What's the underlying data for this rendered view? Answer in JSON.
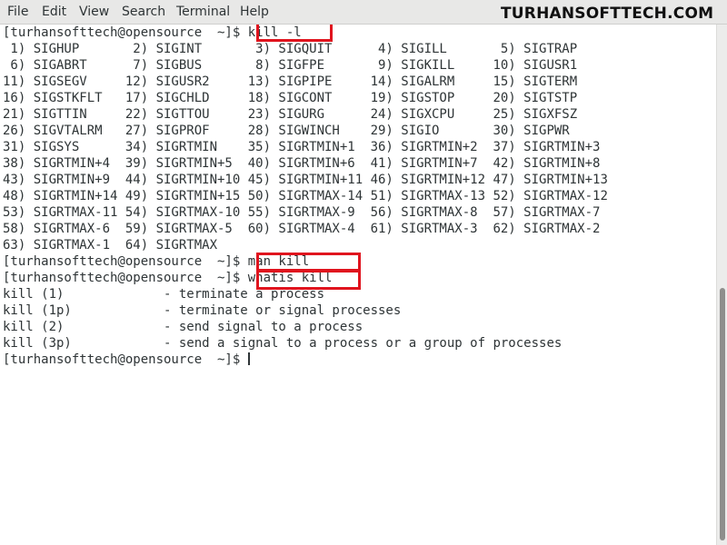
{
  "menu": {
    "file": "File",
    "edit": "Edit",
    "view": "View",
    "search": "Search",
    "terminal": "Terminal",
    "help": "Help"
  },
  "watermark": "TURHANSOFTTECH.COM",
  "terminal": {
    "lines": [
      "[turhansofttech@opensource  ~]$ kill -l",
      " 1) SIGHUP       2) SIGINT       3) SIGQUIT      4) SIGILL       5) SIGTRAP",
      " 6) SIGABRT      7) SIGBUS       8) SIGFPE       9) SIGKILL     10) SIGUSR1",
      "11) SIGSEGV     12) SIGUSR2     13) SIGPIPE     14) SIGALRM     15) SIGTERM",
      "16) SIGSTKFLT   17) SIGCHLD     18) SIGCONT     19) SIGSTOP     20) SIGTSTP",
      "21) SIGTTIN     22) SIGTTOU     23) SIGURG      24) SIGXCPU     25) SIGXFSZ",
      "26) SIGVTALRM   27) SIGPROF     28) SIGWINCH    29) SIGIO       30) SIGPWR",
      "31) SIGSYS      34) SIGRTMIN    35) SIGRTMIN+1  36) SIGRTMIN+2  37) SIGRTMIN+3",
      "38) SIGRTMIN+4  39) SIGRTMIN+5  40) SIGRTMIN+6  41) SIGRTMIN+7  42) SIGRTMIN+8",
      "43) SIGRTMIN+9  44) SIGRTMIN+10 45) SIGRTMIN+11 46) SIGRTMIN+12 47) SIGRTMIN+13",
      "48) SIGRTMIN+14 49) SIGRTMIN+15 50) SIGRTMAX-14 51) SIGRTMAX-13 52) SIGRTMAX-12",
      "53) SIGRTMAX-11 54) SIGRTMAX-10 55) SIGRTMAX-9  56) SIGRTMAX-8  57) SIGRTMAX-7",
      "58) SIGRTMAX-6  59) SIGRTMAX-5  60) SIGRTMAX-4  61) SIGRTMAX-3  62) SIGRTMAX-2",
      "63) SIGRTMAX-1  64) SIGRTMAX",
      "[turhansofttech@opensource  ~]$ man kill",
      "[turhansofttech@opensource  ~]$ whatis kill",
      "kill (1)             - terminate a process",
      "kill (1p)            - terminate or signal processes",
      "kill (2)             - send signal to a process",
      "kill (3p)            - send a signal to a process or a group of processes",
      "[turhansofttech@opensource  ~]$ "
    ]
  },
  "colors": {
    "highlight": "#e0141e",
    "text": "#2e3436",
    "menubar": "#e8e8e7"
  }
}
